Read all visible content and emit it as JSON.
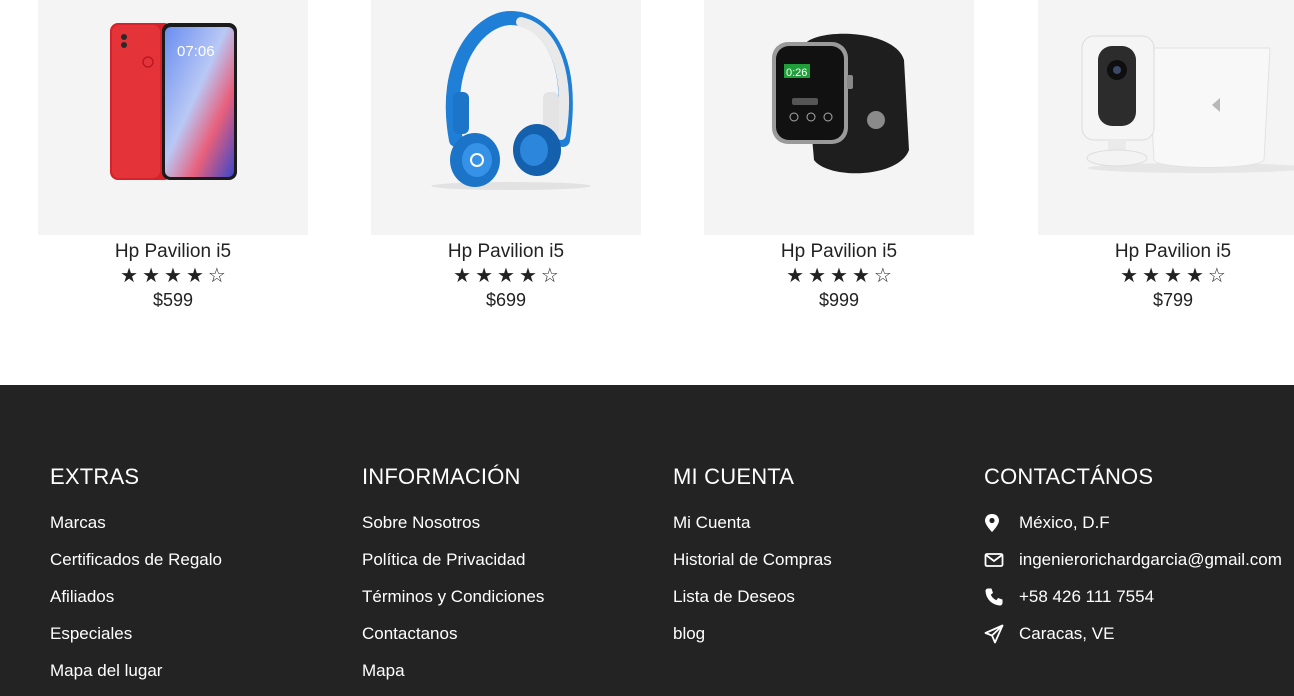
{
  "products": [
    {
      "name": "Hp Pavilion i5",
      "rating": 4,
      "stars": "★★★★☆",
      "price": "$599",
      "image_icon": "red-smartphone-image"
    },
    {
      "name": "Hp Pavilion i5",
      "rating": 4,
      "stars": "★★★★☆",
      "price": "$699",
      "image_icon": "blue-headphones-image"
    },
    {
      "name": "Hp Pavilion i5",
      "rating": 4,
      "stars": "★★★★☆",
      "price": "$999",
      "image_icon": "smartwatch-image"
    },
    {
      "name": "Hp Pavilion i5",
      "rating": 4,
      "stars": "★★★★☆",
      "price": "$799",
      "image_icon": "security-camera-image"
    }
  ],
  "footer": {
    "background": "#232323",
    "extras": {
      "title": "EXTRAS",
      "links": [
        "Marcas",
        "Certificados de Regalo",
        "Afiliados",
        "Especiales",
        "Mapa del lugar"
      ]
    },
    "informacion": {
      "title": "INFORMACIÓN",
      "links": [
        "Sobre Nosotros",
        "Política de Privacidad",
        "Términos y Condiciones",
        "Contactanos",
        "Mapa"
      ]
    },
    "mi_cuenta": {
      "title": "MI CUENTA",
      "links": [
        "Mi Cuenta",
        "Historial de Compras",
        "Lista de Deseos",
        "blog"
      ]
    },
    "contacto": {
      "title": "CONTACTÁNOS",
      "items": [
        {
          "icon": "map-marker-icon",
          "text": "México, D.F"
        },
        {
          "icon": "envelope-icon",
          "text": "ingenierorichardgarcia@gmail.com"
        },
        {
          "icon": "phone-icon",
          "text": "+58 426 111 7554"
        },
        {
          "icon": "paper-plane-icon",
          "text": "Caracas, VE"
        }
      ]
    }
  }
}
